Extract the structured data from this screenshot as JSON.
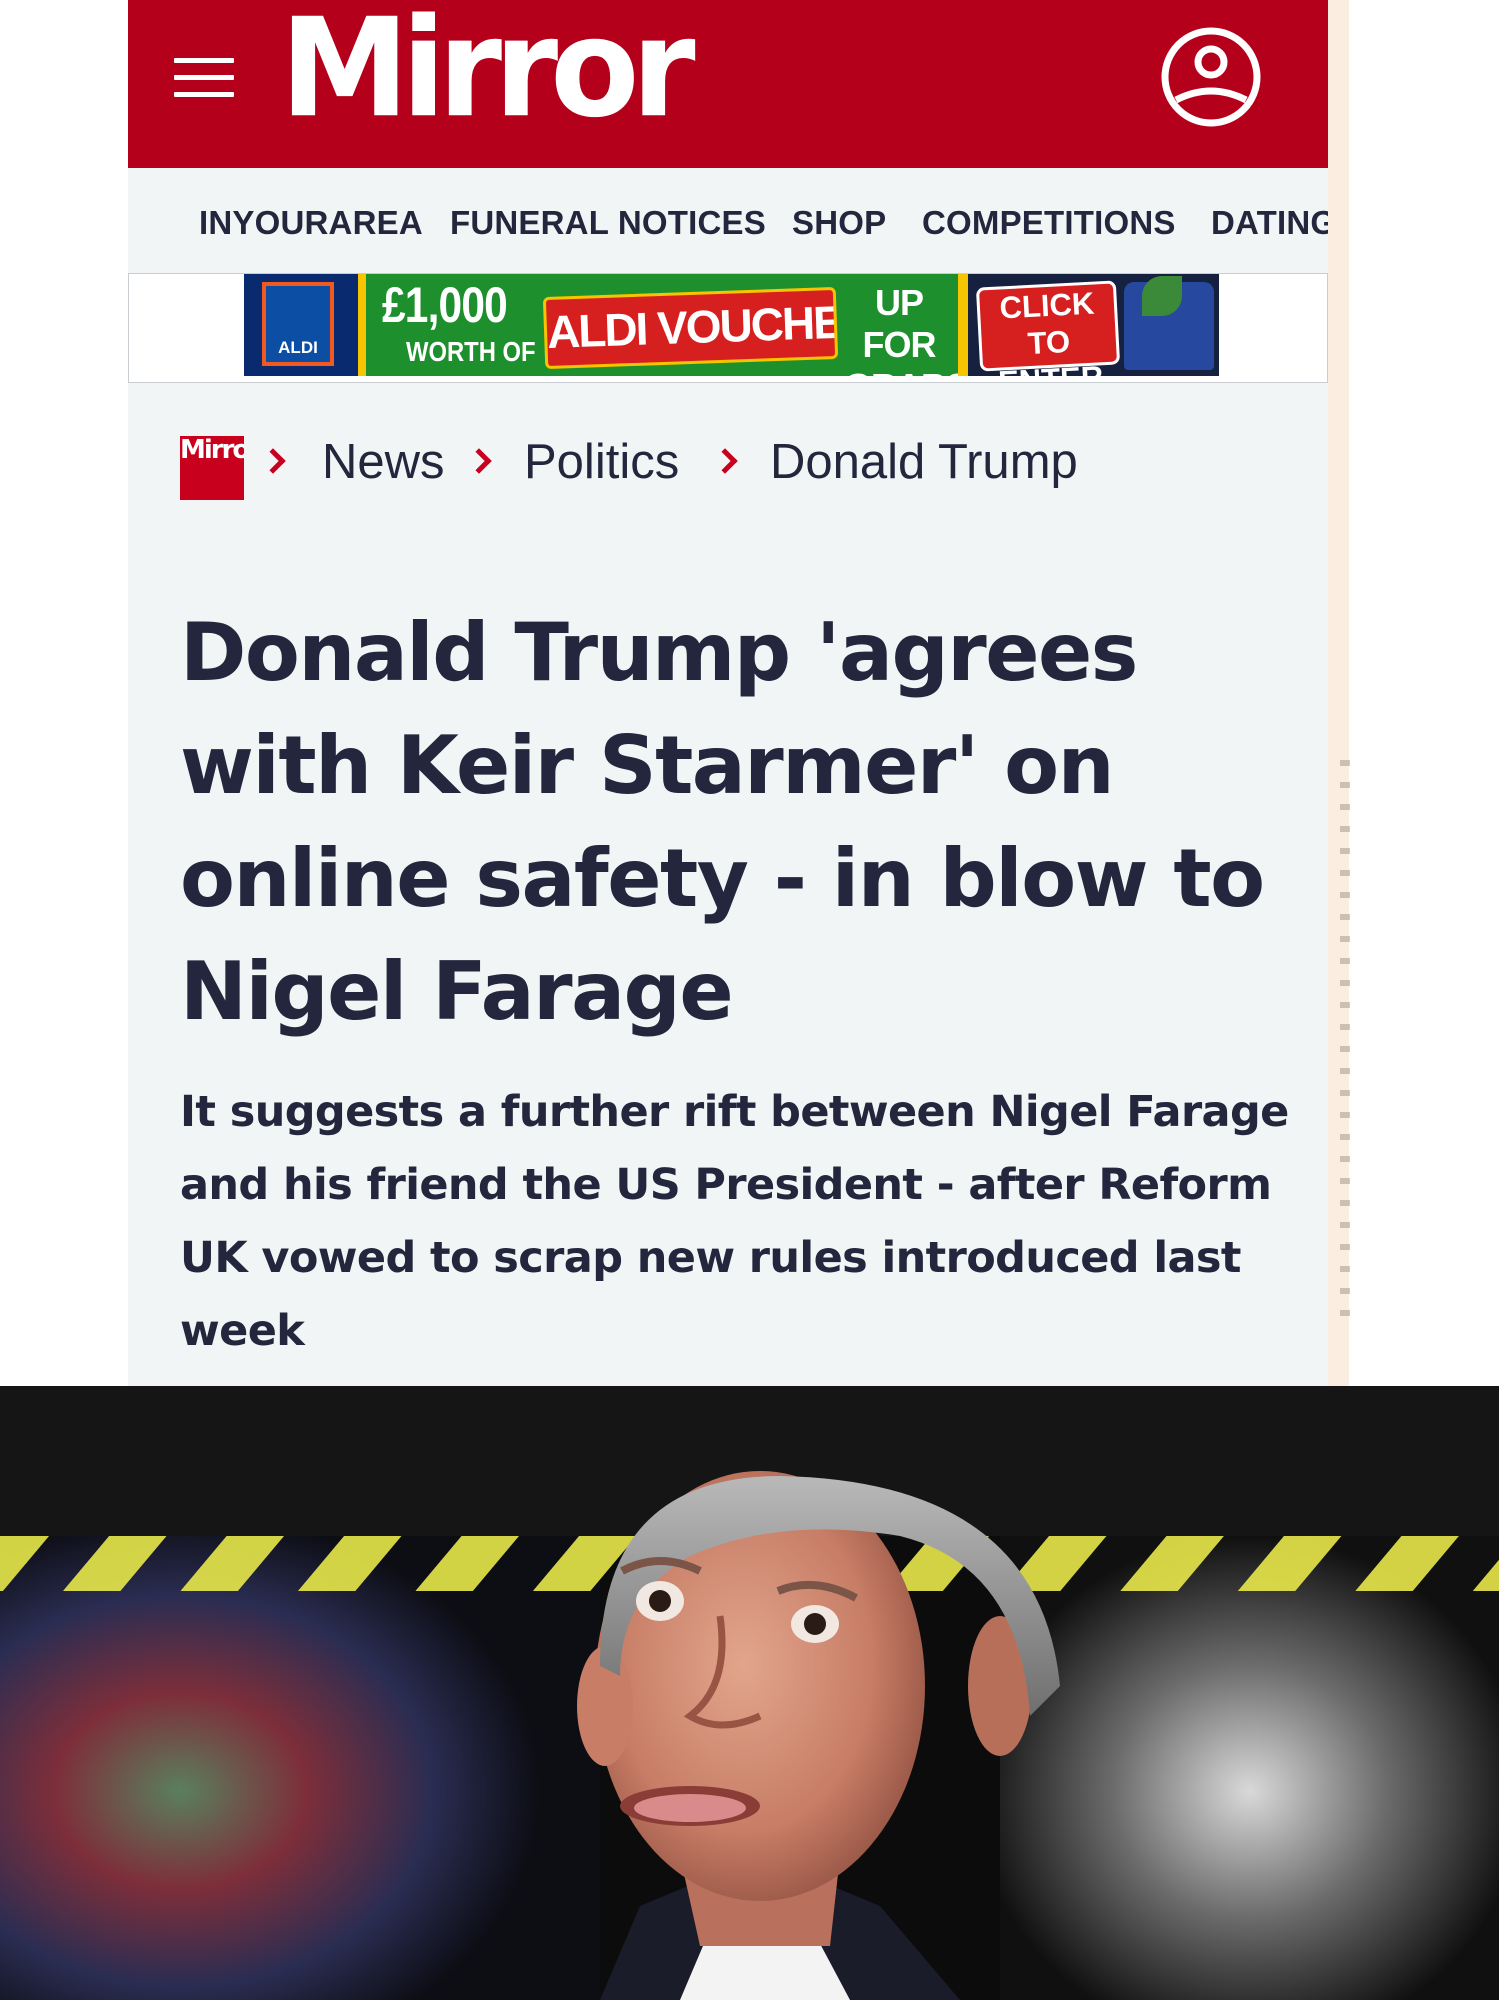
{
  "header": {
    "logo_text": "Mirror",
    "brand_color": "#b5001c"
  },
  "nav": {
    "items": [
      "INYOURAREA",
      "FUNERAL NOTICES",
      "SHOP",
      "COMPETITIONS",
      "DATING"
    ]
  },
  "ad": {
    "logo_text": "ALDI",
    "amount": "£1,000",
    "worth_of": "WORTH OF",
    "vouchers": "ALDI VOUCHERS",
    "up_for": "UP FOR",
    "grabs": "GRABS",
    "click_to": "CLICK TO",
    "enter": "ENTER"
  },
  "breadcrumb": {
    "logo_text": "Mirror",
    "items": [
      "News",
      "Politics",
      "Donald Trump"
    ]
  },
  "article": {
    "headline_lines": [
      "Donald Trump 'agrees",
      "with Keir Starmer' on",
      "online safety - in blow to",
      "Nigel Farage"
    ],
    "standfirst_lines": [
      "It suggests a further rift between Nigel Farage",
      "and his friend the US President - after Reform",
      "UK vowed to scrap new rules introduced last",
      "week"
    ]
  },
  "photo": {
    "subject": "Nigel Farage with a surprised expression against a dark background with yellow hazard stripes"
  }
}
